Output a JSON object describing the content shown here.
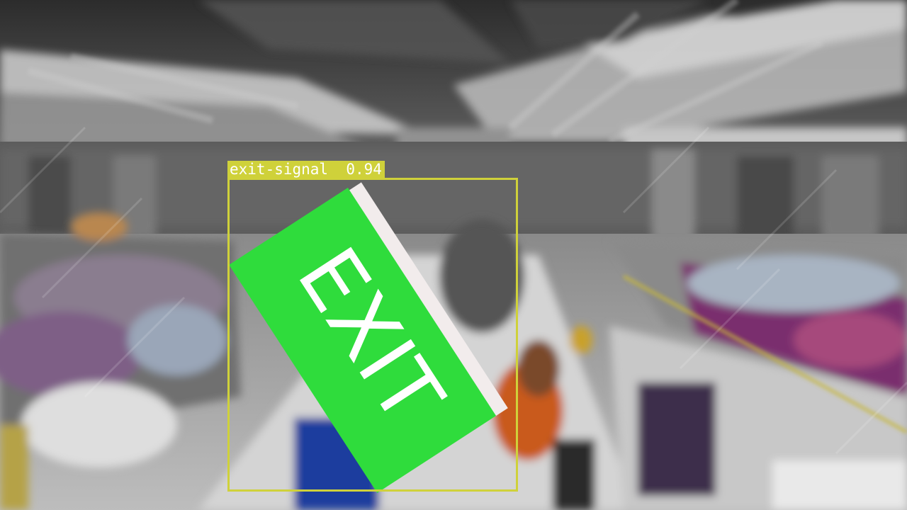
{
  "image": {
    "scene": "grayscale blurred warehouse interior with green EXIT sign",
    "box_color": "#cfd13a",
    "sign_color": "#2fdc3c"
  },
  "detection": {
    "label": "exit-signal",
    "confidence": "0.94"
  },
  "sign": {
    "text": "EXIT"
  }
}
